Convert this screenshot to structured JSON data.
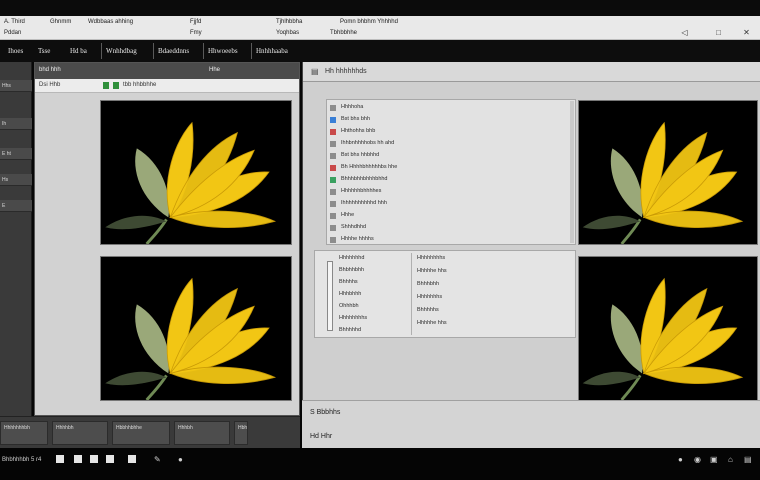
{
  "menu": {
    "app_title": "A. Third",
    "items_row1": [
      "Ghnmm",
      "Wdbbaas ahhing",
      "Fjjfd",
      "Tjhlhbbha",
      "Pomn bhbhm Yhhhhd"
    ],
    "items_row2": [
      "Pddan",
      "Fmy",
      "Yoqhbas",
      "Tbhbbhhe"
    ],
    "window_controls": [
      "◁",
      "□",
      "✕"
    ]
  },
  "toolbar": {
    "tabs": [
      "Ihoes",
      "Tsse",
      "Hd ba",
      "Wnhhdbag",
      "Bdaeddnns",
      "Hhwoeebs",
      "Hnhhhaaba"
    ]
  },
  "left_strip": {
    "items": [
      "Hhs",
      "Ih",
      "E ht",
      "Hs",
      "E"
    ]
  },
  "left_panel": {
    "header": "bhd hhh",
    "header_right": "Hhe",
    "subheader": [
      "Dsi Hhb",
      "tbb hhbbhhe"
    ]
  },
  "right_panel": {
    "title": "Hh hhhhhhds",
    "list_items": [
      "Hhhhoha",
      "Bst bhs bhh",
      "Hhthohhs bhb",
      "Ihhbnhhhhobs hh ahd",
      "Bst bhs hhbhhd",
      "Bh Hhhhbhhhhhbs hhe",
      "Bhhhbhhbhhhbhhd",
      "Hhhhhhbhhhhes",
      "Ihhhhhhhhhhd hhh",
      "Hhhe",
      "Shhhdhhd",
      "Hhhhe hhhhs"
    ],
    "sub_left": [
      "Hhhhhhhd",
      "Bhbhhbhh",
      "Bhhhhs",
      "Hhhbhhh",
      "Ohhhbh",
      "Hhhhhhhhs",
      "Bhhhhhd"
    ],
    "sub_right": [
      "Hhhhhhhhs",
      "Hhhhhe hhs",
      "Bhhhbhh",
      "Hhhhhhhs",
      "Bhhhhhs",
      "Hhhhhe hhs"
    ],
    "footer_line1": "S  Bbbhhs",
    "footer_line2": "Hd  Hhr"
  },
  "left_bottom": {
    "cells": [
      "Hhhhhhhbh",
      "Hhhhbh",
      "Hbbhhbhhe",
      "Hhhbh",
      "Hbh"
    ]
  },
  "status": {
    "left_text": "Bhbhhhbh 5 r4",
    "icons": [
      "■",
      "■",
      "■",
      "■",
      "■"
    ],
    "tray": [
      "●",
      "◉",
      "▣",
      "⌂",
      "▤"
    ]
  },
  "colors": {
    "flower_yellow": "#f2c614",
    "leaf_green": "#9aa879",
    "background": "#000000"
  }
}
